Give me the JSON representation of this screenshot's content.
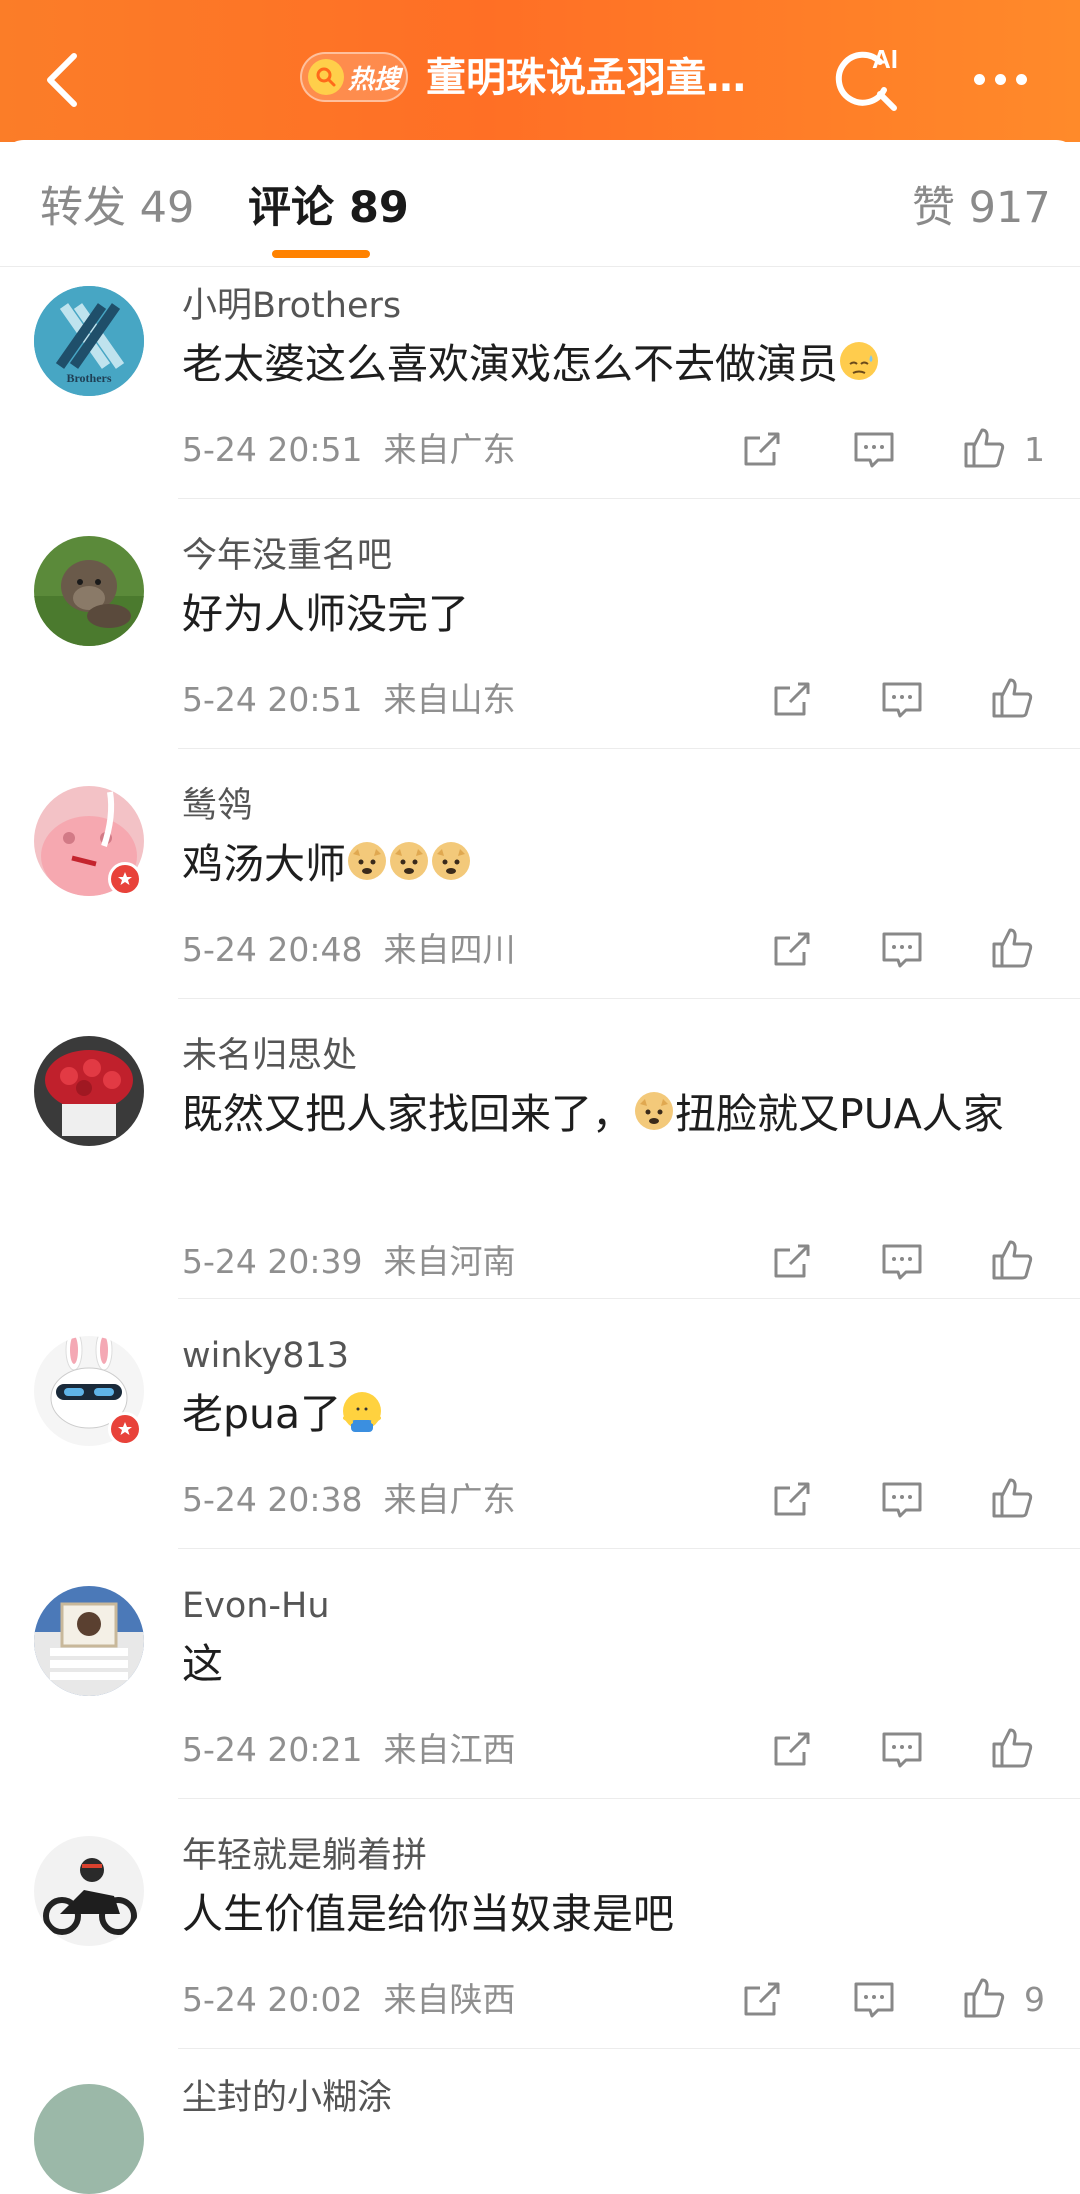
{
  "header": {
    "hot_label": "热搜",
    "title": "董明珠说孟羽童…",
    "ai_label": "AI"
  },
  "tabs": {
    "forward": "转发 49",
    "comments": "评论 89",
    "likes": "赞 917"
  },
  "comments": [
    {
      "user": "小明Brothers",
      "text": "老太婆这么喜欢演戏怎么不去做演员",
      "time": "5-24 20:51",
      "location": "来自广东",
      "likes": "1",
      "avatar_label": "Brothers"
    },
    {
      "user": "今年没重名吧",
      "text": "好为人师没完了",
      "time": "5-24 20:51",
      "location": "来自山东",
      "likes": ""
    },
    {
      "user": "鸶鸰",
      "text": "鸡汤大师",
      "time": "5-24 20:48",
      "location": "来自四川",
      "likes": ""
    },
    {
      "user": "未名归思处",
      "text_a": "既然又把人家找回来了，",
      "text_b": "扭脸就又PUA人家",
      "time": "5-24 20:39",
      "location": "来自河南",
      "likes": ""
    },
    {
      "user": "winky813",
      "text": "老pua了",
      "time": "5-24 20:38",
      "location": "来自广东",
      "likes": ""
    },
    {
      "user": "Evon-Hu",
      "text": "这",
      "time": "5-24 20:21",
      "location": "来自江西",
      "likes": ""
    },
    {
      "user": "年轻就是躺着拼",
      "text": "人生价值是给你当奴隶是吧",
      "time": "5-24 20:02",
      "location": "来自陕西",
      "likes": "9"
    },
    {
      "user": "尘封的小糊涂"
    }
  ],
  "colors": {
    "header_gradient_start": "#fb7d28",
    "header_gradient_end": "#ff8a2a",
    "tab_underline": "#ff8200",
    "badge_red": "#e8423a"
  },
  "icons": [
    "back-arrow-icon",
    "search-icon",
    "ai-search-icon",
    "more-icon",
    "share-icon",
    "comment-icon",
    "like-icon",
    "sweat-emoji-icon",
    "doge-emoji-icon",
    "shrug-emoji-icon"
  ]
}
